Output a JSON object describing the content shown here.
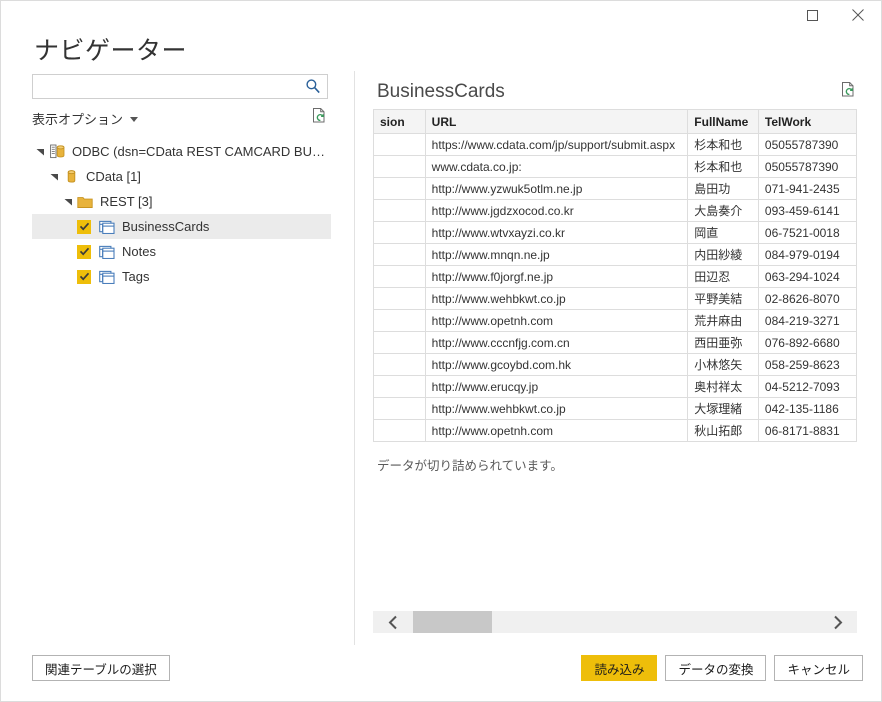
{
  "window": {
    "title": "ナビゲーター",
    "controls": {
      "restore_label": "元に戻す",
      "close_label": "閉じる"
    }
  },
  "search": {
    "value": "",
    "placeholder": "",
    "icon": "search-icon"
  },
  "left_pane": {
    "display_options_label": "表示オプション",
    "refresh_icon": "refresh-document-icon",
    "tree": [
      {
        "label": "ODBC (dsn=CData REST CAMCARD BUSINESS)...",
        "level": 0,
        "icon": "server-database-icon",
        "expanded": true,
        "checkbox": null,
        "selected": false
      },
      {
        "label": "CData [1]",
        "level": 1,
        "icon": "database-icon",
        "expanded": true,
        "checkbox": null,
        "selected": false
      },
      {
        "label": "REST [3]",
        "level": 2,
        "icon": "folder-icon",
        "expanded": true,
        "checkbox": null,
        "selected": false
      },
      {
        "label": "BusinessCards",
        "level": 3,
        "icon": "table-icon",
        "expanded": null,
        "checkbox": true,
        "selected": true
      },
      {
        "label": "Notes",
        "level": 3,
        "icon": "table-icon",
        "expanded": null,
        "checkbox": true,
        "selected": false
      },
      {
        "label": "Tags",
        "level": 3,
        "icon": "table-icon",
        "expanded": null,
        "checkbox": true,
        "selected": false
      }
    ]
  },
  "preview": {
    "title": "BusinessCards",
    "refresh_icon": "refresh-document-icon",
    "truncation_note": "データが切り詰められています。",
    "columns": [
      "sion",
      "URL",
      "FullName",
      "TelWork"
    ],
    "rows": [
      [
        "",
        "https://www.cdata.com/jp/support/submit.aspx",
        "杉本和也",
        "05055787390"
      ],
      [
        "",
        "www.cdata.co.jp:",
        "杉本和也",
        "05055787390"
      ],
      [
        "",
        "http://www.yzwuk5otlm.ne.jp",
        "島田功",
        "071-941-2435"
      ],
      [
        "",
        "http://www.jgdzxocod.co.kr",
        "大島奏介",
        "093-459-6141"
      ],
      [
        "",
        "http://www.wtvxayzi.co.kr",
        "岡直",
        "06-7521-0018"
      ],
      [
        "",
        "http://www.mnqn.ne.jp",
        "内田紗綾",
        "084-979-0194"
      ],
      [
        "",
        "http://www.f0jorgf.ne.jp",
        "田辺忍",
        "063-294-1024"
      ],
      [
        "",
        "http://www.wehbkwt.co.jp",
        "平野美結",
        "02-8626-8070"
      ],
      [
        "",
        "http://www.opetnh.com",
        "荒井麻由",
        "084-219-3271"
      ],
      [
        "",
        "http://www.cccnfjg.com.cn",
        "西田亜弥",
        "076-892-6680"
      ],
      [
        "",
        "http://www.gcoybd.com.hk",
        "小林悠矢",
        "058-259-8623"
      ],
      [
        "",
        "http://www.erucqy.jp",
        "奥村祥太",
        "04-5212-7093"
      ],
      [
        "",
        "http://www.wehbkwt.co.jp",
        "大塚理緒",
        "042-135-1186"
      ],
      [
        "",
        "http://www.opetnh.com",
        "秋山拓郎",
        "06-8171-8831"
      ]
    ],
    "scrollbar": {
      "left_arrow": "chevron-left-icon",
      "right_arrow": "chevron-right-icon"
    }
  },
  "footer": {
    "related_tables_label": "関連テーブルの選択",
    "load_label": "読み込み",
    "transform_label": "データの変換",
    "cancel_label": "キャンセル"
  },
  "colors": {
    "accent_gold": "#eebe0a",
    "icon_blue": "#4a7ebb",
    "selection_gray": "#ebebeb",
    "border_gray": "#dddddd"
  }
}
